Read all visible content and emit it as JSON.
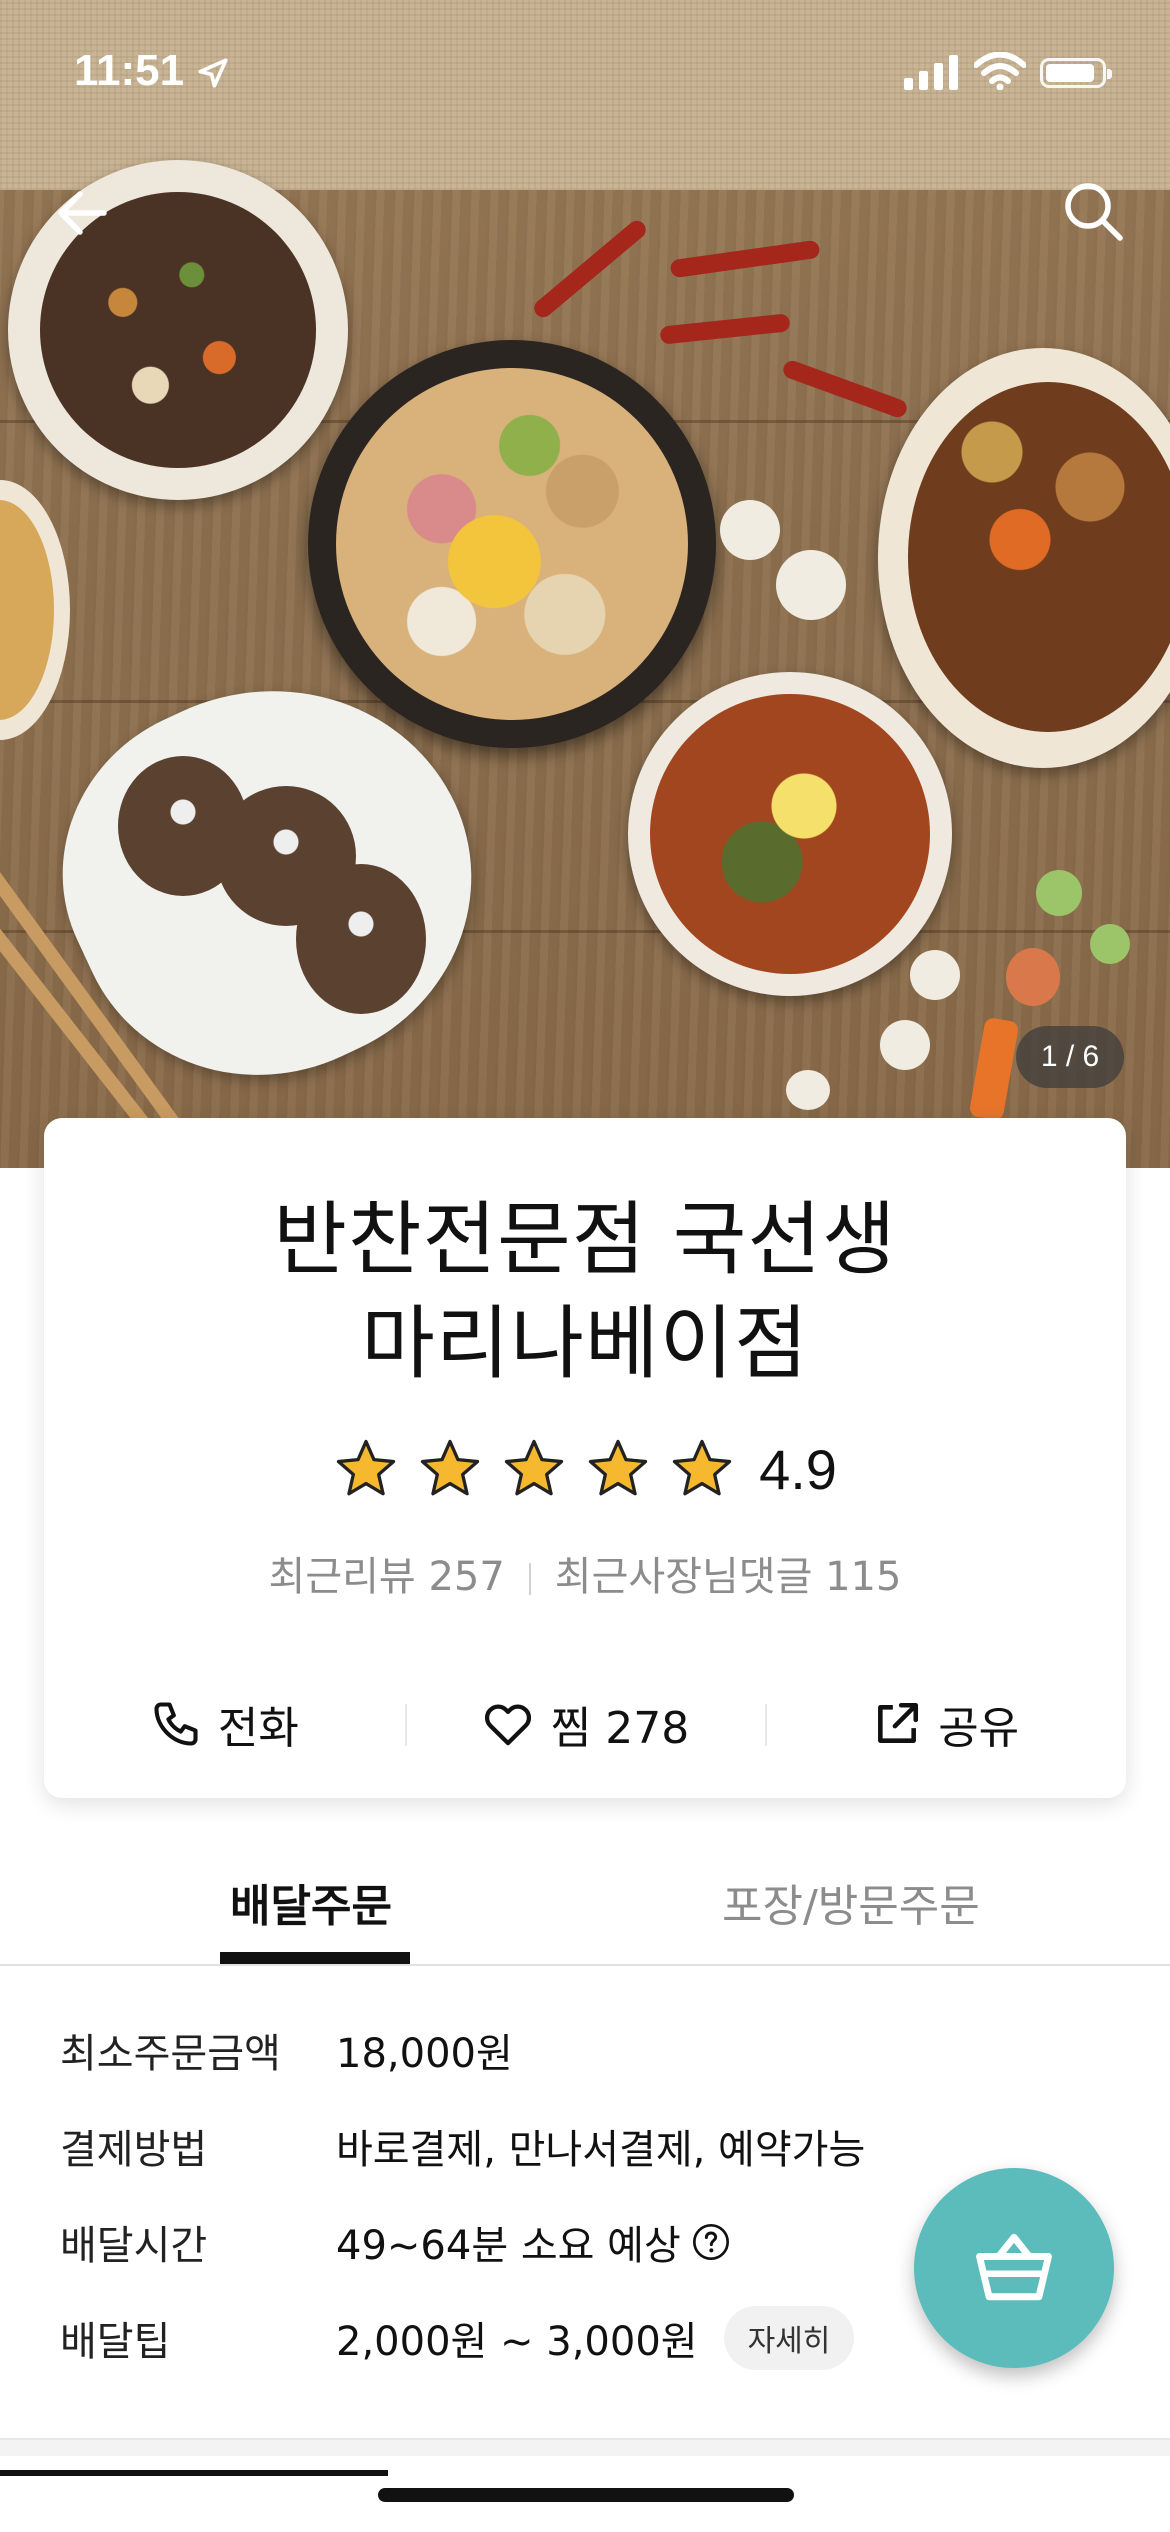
{
  "status_bar": {
    "time": "11:51"
  },
  "hero": {
    "image_counter": "1 / 6"
  },
  "store": {
    "name_line1": "반찬전문점 국선생",
    "name_line2": "마리나베이점",
    "rating": "4.9",
    "stars": 5,
    "recent_reviews": "최근리뷰 257",
    "owner_replies": "최근사장님댓글 115"
  },
  "actions": {
    "call": "전화",
    "favorite": "찜 278",
    "share": "공유"
  },
  "order_tabs": {
    "delivery": "배달주문",
    "pickup": "포장/방문주문"
  },
  "info": {
    "min_order_label": "최소주문금액",
    "min_order_value": "18,000원",
    "payment_label": "결제방법",
    "payment_value": "바로결제, 만나서결제, 예약가능",
    "time_label": "배달시간",
    "time_value": "49~64분 소요 예상",
    "tip_label": "배달팁",
    "tip_value": "2,000원 ~ 3,000원",
    "tip_detail": "자세히"
  },
  "colors": {
    "accent": "#5cbcbc",
    "star": "#f5b82e"
  }
}
